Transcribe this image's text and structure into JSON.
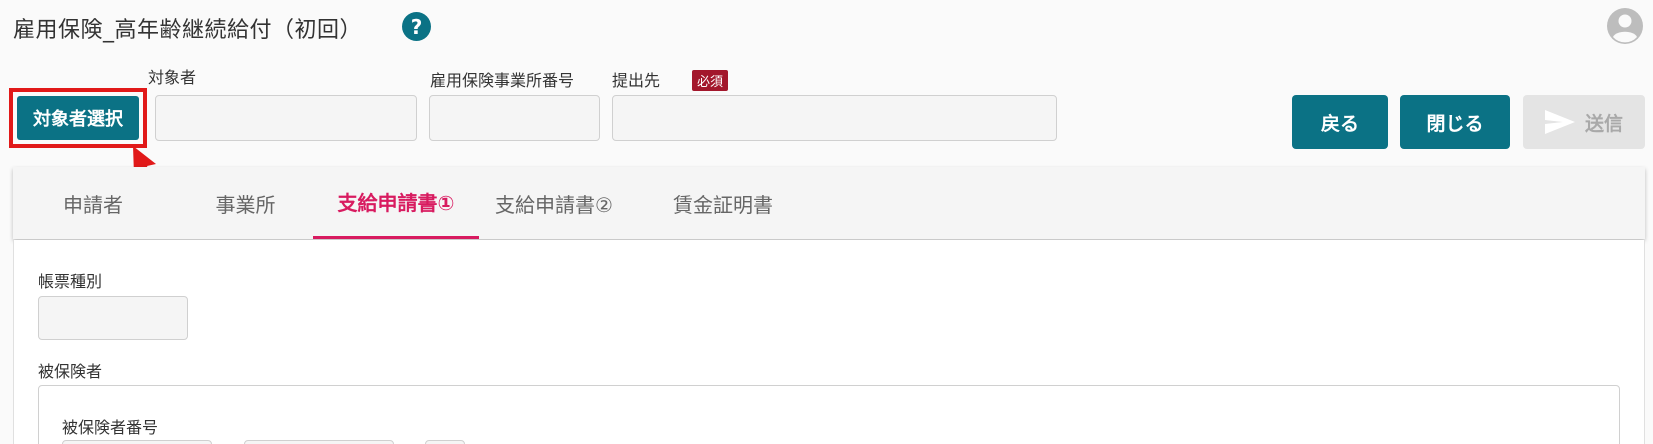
{
  "header": {
    "title": "雇用保険_高年齢継続給付（初回）",
    "help_icon": "?"
  },
  "form": {
    "select_button": "対象者選択",
    "target_label": "対象者",
    "office_no_label": "雇用保険事業所番号",
    "destination_label": "提出先",
    "required_badge": "必須"
  },
  "actions": {
    "back": "戻る",
    "close": "閉じる",
    "send": "送信"
  },
  "tabs": [
    {
      "label": "申請者",
      "active": false
    },
    {
      "label": "事業所",
      "active": false
    },
    {
      "label": "支給申請書①",
      "active": true
    },
    {
      "label": "支給申請書②",
      "active": false
    },
    {
      "label": "賃金証明書",
      "active": false
    }
  ],
  "content": {
    "form_type_label": "帳票種別",
    "insured_section": "被保険者",
    "insured_no_label": "被保険者番号"
  },
  "colors": {
    "primary": "#0b7285",
    "active_tab": "#d81b60",
    "highlight": "#e11919",
    "badge": "#a3172c"
  }
}
